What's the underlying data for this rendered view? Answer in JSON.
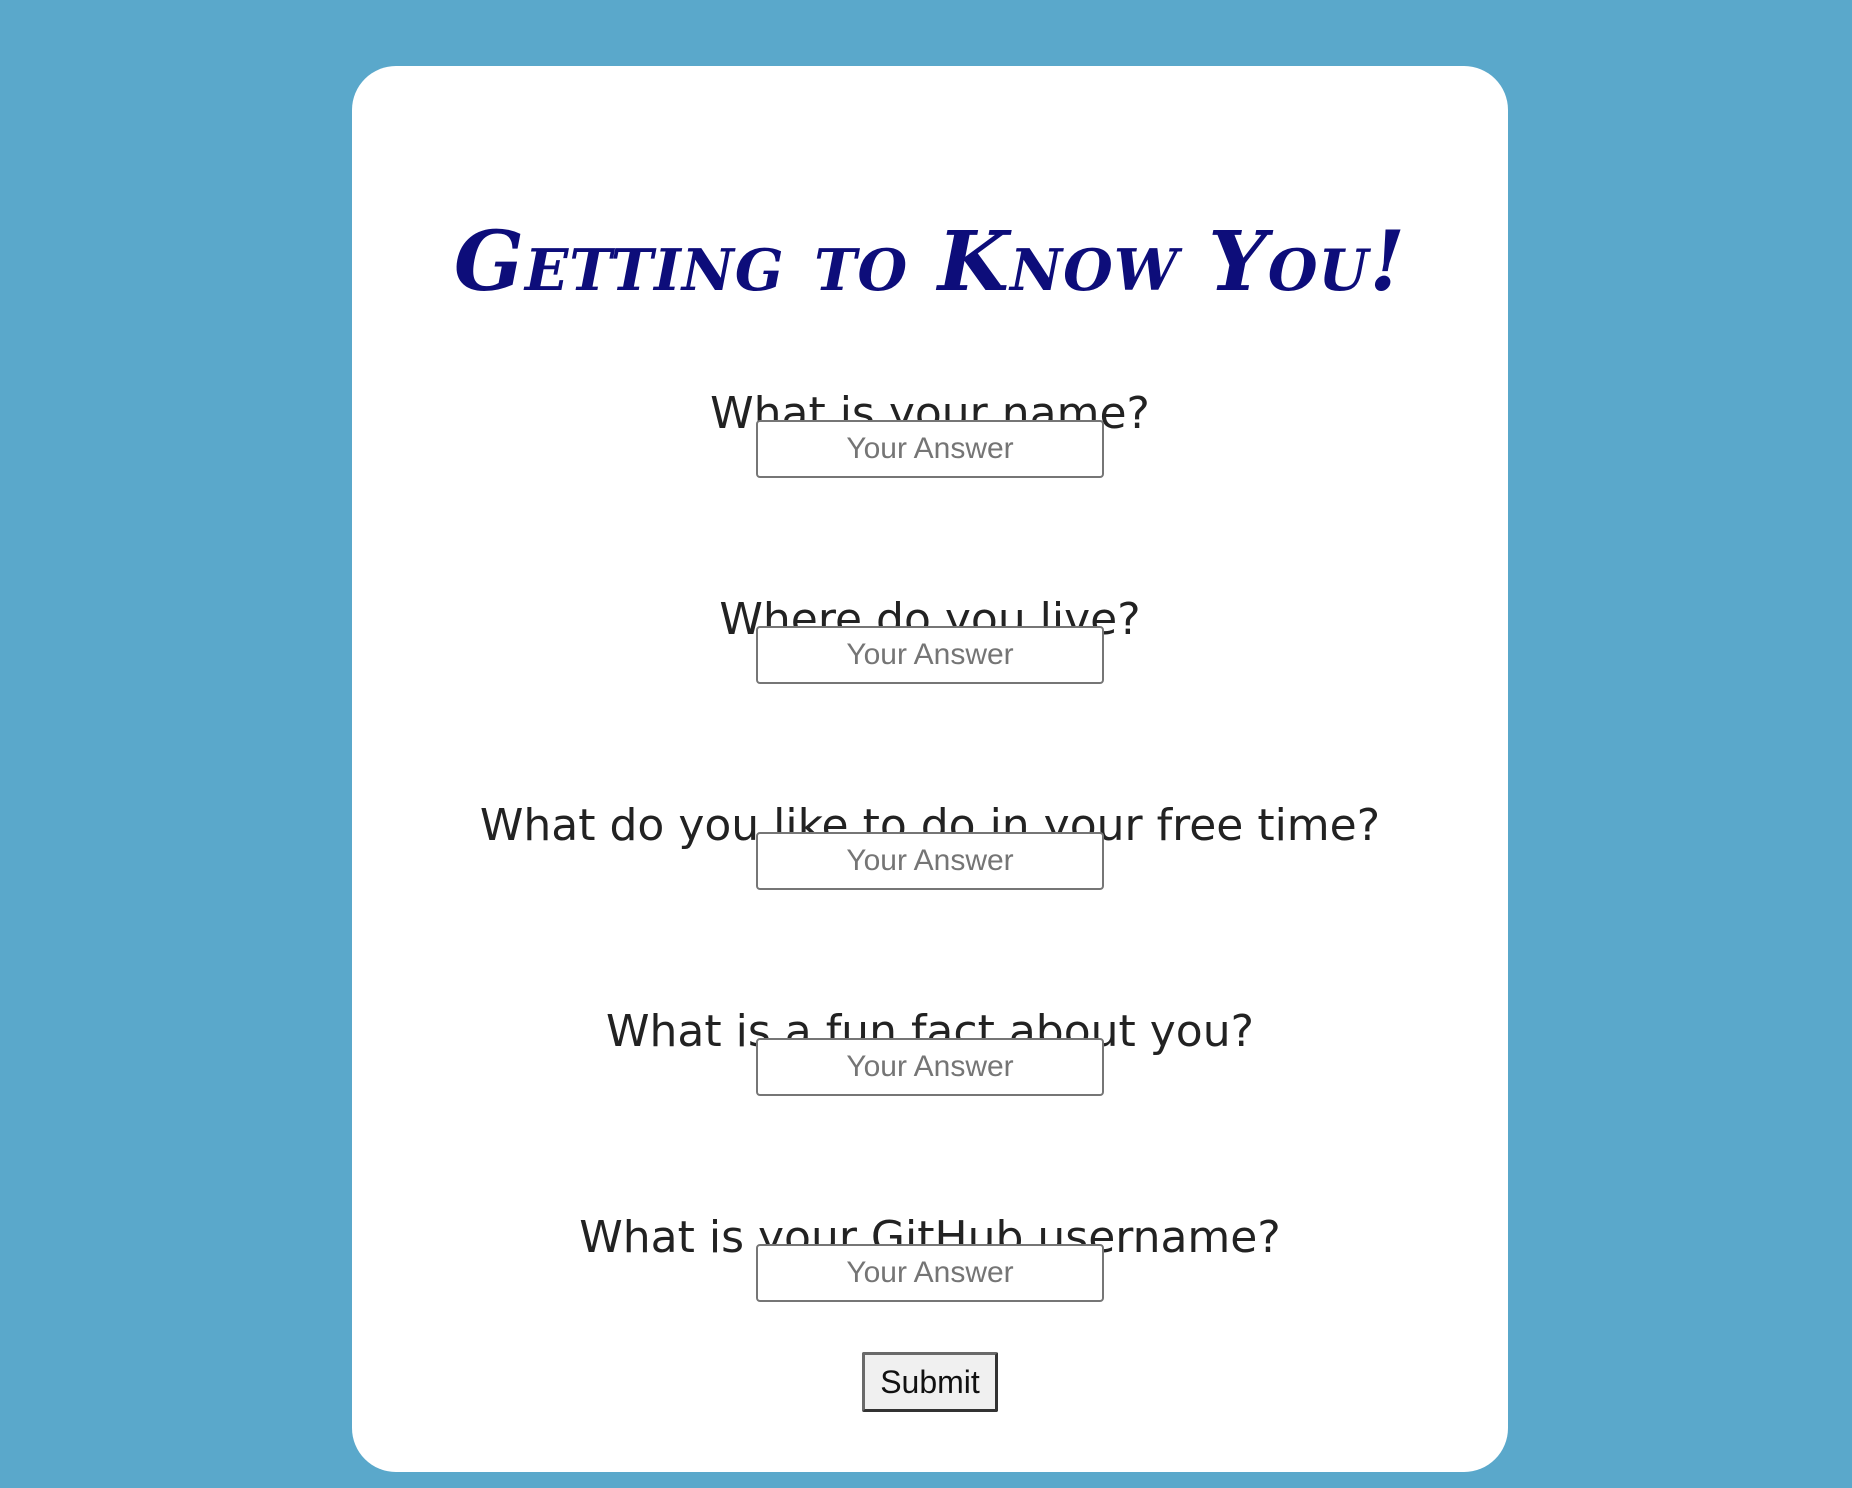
{
  "colors": {
    "page_background": "#5aa8cb",
    "card_background": "#ffffff",
    "title": "#0d0d7a",
    "question_text": "#222222"
  },
  "form": {
    "title": "Getting to Know You!",
    "questions": [
      {
        "label": "What is your name?",
        "placeholder": "Your Answer",
        "value": ""
      },
      {
        "label": "Where do you live?",
        "placeholder": "Your Answer",
        "value": ""
      },
      {
        "label": "What do you like to do in your free time?",
        "placeholder": "Your Answer",
        "value": ""
      },
      {
        "label": "What is a fun fact about you?",
        "placeholder": "Your Answer",
        "value": ""
      },
      {
        "label": "What is your GitHub username?",
        "placeholder": "Your Answer",
        "value": ""
      }
    ],
    "submit_label": "Submit"
  }
}
